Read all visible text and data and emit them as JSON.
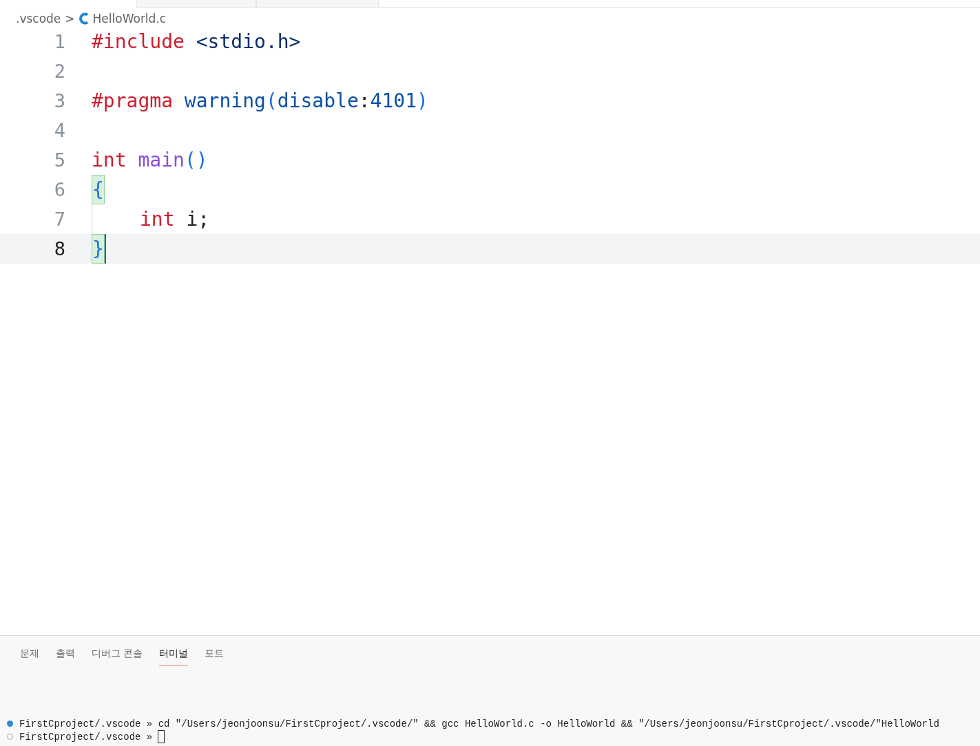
{
  "breadcrumb": {
    "folder": ".vscode",
    "separator": ">",
    "file": "HelloWorld.c"
  },
  "code_lines": [
    {
      "number": "1",
      "current": false,
      "tokens": [
        {
          "text": "#include",
          "kind": "keyword"
        },
        {
          "text": " <stdio.h>",
          "kind": "header"
        }
      ]
    },
    {
      "number": "2",
      "current": false
    },
    {
      "number": "3",
      "current": false,
      "tokens": [
        {
          "text": "#pragma",
          "kind": "keyword"
        },
        {
          "text": " warning",
          "kind": "macro"
        },
        {
          "text": "(",
          "kind": "paren"
        },
        {
          "text": "disable",
          "kind": "macro"
        },
        {
          "text": ":",
          "kind": "plain"
        },
        {
          "text": "4101",
          "kind": "macro"
        },
        {
          "text": ")",
          "kind": "paren"
        }
      ]
    },
    {
      "number": "4",
      "current": false
    },
    {
      "number": "5",
      "current": false,
      "tokens": [
        {
          "text": "int",
          "kind": "keyword"
        },
        {
          "text": " main",
          "kind": "function"
        },
        {
          "text": "()",
          "kind": "paren"
        }
      ]
    },
    {
      "number": "6",
      "current": false,
      "tokens": [
        {
          "text": "{",
          "kind": "bracket-match"
        }
      ]
    },
    {
      "number": "7",
      "current": false,
      "indented": true,
      "tokens": [
        {
          "text": "int",
          "kind": "keyword"
        },
        {
          "text": " i;",
          "kind": "plain"
        }
      ]
    },
    {
      "number": "8",
      "current": true,
      "tokens": [
        {
          "text": "}",
          "kind": "bracket-match"
        }
      ]
    }
  ],
  "panel_tabs": [
    {
      "label": "문제",
      "selected": false
    },
    {
      "label": "출력",
      "selected": false
    },
    {
      "label": "디버그 콘솔",
      "selected": false
    },
    {
      "label": "터미널",
      "selected": true
    },
    {
      "label": "포트",
      "selected": false
    }
  ],
  "terminal_lines": [
    {
      "finished": true,
      "prompt": "FirstCproject/.vscode »",
      "command": "cd \"/Users/jeonjoonsu/FirstCproject/.vscode/\" && gcc HelloWorld.c -o HelloWorld && \"/Users/jeonjoonsu/FirstCproject/.vscode/\"HelloWorld"
    },
    {
      "finished": false,
      "prompt": "FirstCproject/.vscode »",
      "cursor": true
    }
  ]
}
